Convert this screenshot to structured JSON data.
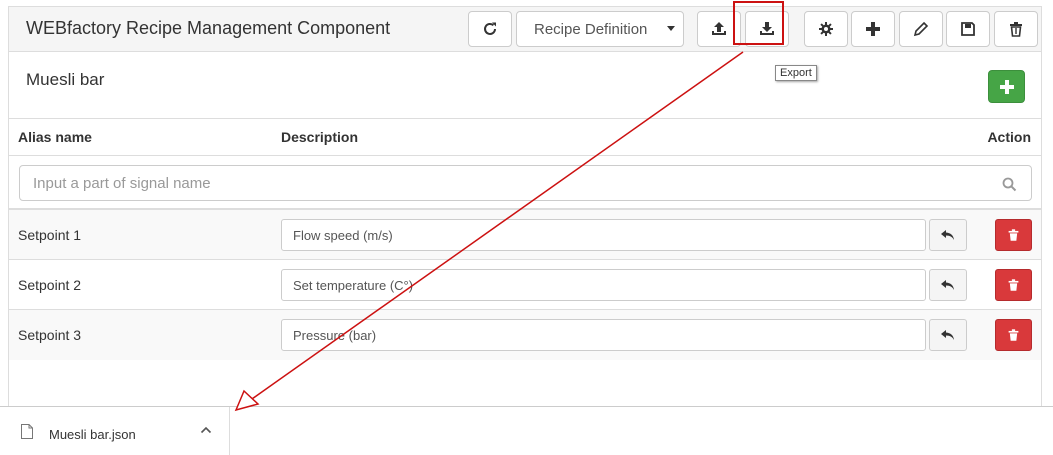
{
  "header": {
    "title": "WEBfactory Recipe Management Component",
    "view_select_value": "Recipe Definition",
    "icons": {
      "refresh": "refresh-icon",
      "import": "upload-icon",
      "export": "download-icon",
      "settings": "gear-icon",
      "add": "plus-icon",
      "edit": "pencil-icon",
      "save": "floppy-icon",
      "delete": "trash-icon"
    },
    "export_tooltip": "Export"
  },
  "recipe": {
    "name": "Muesli bar"
  },
  "table": {
    "columns": [
      "Alias name",
      "Description",
      "Action"
    ],
    "filter_placeholder": "Input a part of signal name",
    "rows": [
      {
        "alias": "Setpoint 1",
        "description": "Flow speed (m/s)"
      },
      {
        "alias": "Setpoint 2",
        "description": "Set temperature (C°)"
      },
      {
        "alias": "Setpoint 3",
        "description": "Pressure (bar)"
      }
    ]
  },
  "downloads": {
    "file_name": "Muesli bar.json"
  },
  "colors": {
    "annotation_red": "#cc1111",
    "add_green": "#46a546",
    "delete_red": "#d9393b"
  }
}
